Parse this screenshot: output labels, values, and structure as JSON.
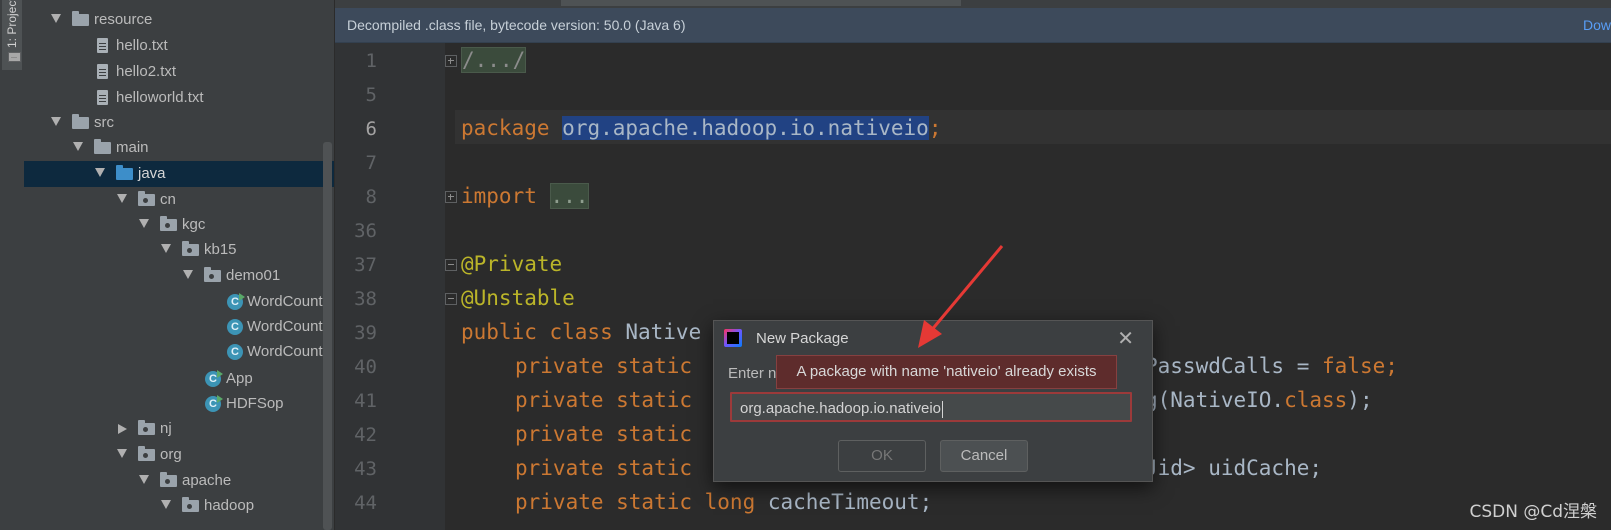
{
  "toolstrip": {
    "project_tab": "1: Project"
  },
  "tree": {
    "items": [
      {
        "label": "resource",
        "kind": "folder"
      },
      {
        "label": "hello.txt",
        "kind": "file"
      },
      {
        "label": "hello2.txt",
        "kind": "file"
      },
      {
        "label": "helloworld.txt",
        "kind": "file"
      },
      {
        "label": "src",
        "kind": "folder"
      },
      {
        "label": "main",
        "kind": "folder"
      },
      {
        "label": "java",
        "kind": "source-folder"
      },
      {
        "label": "cn",
        "kind": "package"
      },
      {
        "label": "kgc",
        "kind": "package"
      },
      {
        "label": "kb15",
        "kind": "package"
      },
      {
        "label": "demo01",
        "kind": "package"
      },
      {
        "label": "WordCountI",
        "kind": "class"
      },
      {
        "label": "WordCountI",
        "kind": "class"
      },
      {
        "label": "WordCountI",
        "kind": "class"
      },
      {
        "label": "App",
        "kind": "class-run"
      },
      {
        "label": "HDFSop",
        "kind": "class-run"
      },
      {
        "label": "nj",
        "kind": "package"
      },
      {
        "label": "org",
        "kind": "package"
      },
      {
        "label": "apache",
        "kind": "package"
      },
      {
        "label": "hadoop",
        "kind": "package"
      }
    ],
    "class_icon_letter": "C"
  },
  "banner": {
    "text": "Decompiled .class file, bytecode version: 50.0 (Java 6)",
    "link": "Dow"
  },
  "editor": {
    "line_numbers": [
      "1",
      "5",
      "6",
      "7",
      "8",
      "36",
      "37",
      "38",
      "39",
      "40",
      "41",
      "42",
      "43",
      "44"
    ],
    "code": {
      "l1": "/.../",
      "l6_kw": "package",
      "l6_pkg": "org.apache.hadoop.io.nativeio",
      "l6_semi": ";",
      "l8_kw": "import",
      "l8_fold": "...",
      "l37": "@Private",
      "l38": "@Unstable",
      "l39_kw": "public class",
      "l39_rest": " Native",
      "l40_kw": "private static",
      "l40_rest": "PasswdCalls = ",
      "l40_false": "false",
      "l40_end": ";",
      "l41_kw": "private static",
      "l41_rest": "g(NativeIO.",
      "l41_class": "class",
      "l41_end": ");",
      "l42_kw": "private static",
      "l43_kw": "private static",
      "l43_rest": "Jid> uidCache;",
      "l44_kw": "private static long",
      "l44_rest": " cacheTimeout;"
    }
  },
  "dialog": {
    "title": "New Package",
    "enter_label": "Enter n",
    "error": "A package with name 'nativeio' already exists",
    "input_value": "org.apache.hadoop.io.nativeio",
    "ok": "OK",
    "cancel": "Cancel",
    "close": "✕"
  },
  "watermark": "CSDN @Cd涅槃",
  "colors": {
    "keyword": "#cc7832",
    "annotation": "#bbb529",
    "selection": "#214283",
    "error_border": "#9c3a3a",
    "arrow": "#e53935"
  }
}
